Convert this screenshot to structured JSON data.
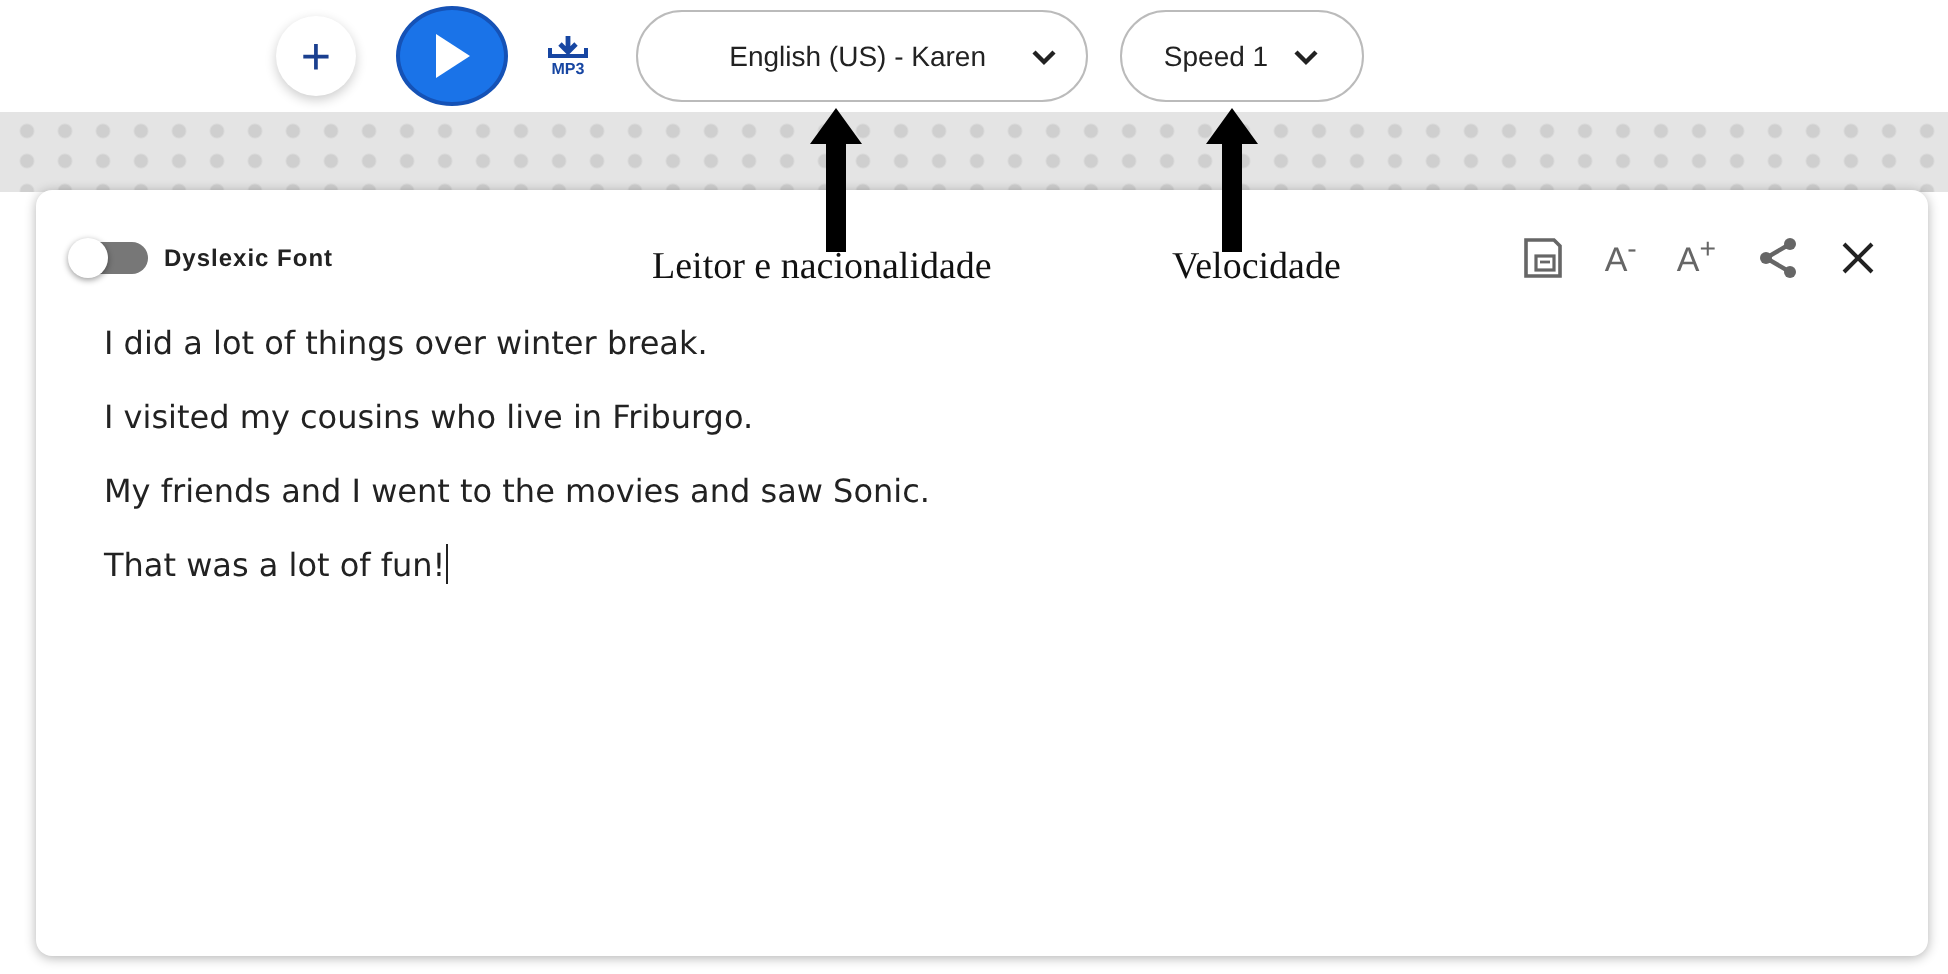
{
  "toolbar": {
    "add_button": "+",
    "mp3_label": "MP3",
    "voice": {
      "label": "English (US) - Karen"
    },
    "speed": {
      "label": "Speed 1"
    }
  },
  "annotations": [
    {
      "label": "Leitor e nacionalidade"
    },
    {
      "label": "Velocidade"
    }
  ],
  "editor": {
    "dyslexic_font": {
      "label": "Dyslexic Font",
      "on": false
    },
    "font_decrease": "A$^{-}$",
    "font_increase": "A$^{+}$",
    "lines": [
      "I did a lot of things over winter break.",
      "I visited my cousins who live in Friburgo.",
      "My friends and I went to the movies and saw Sonic.",
      "That was a lot of fun!"
    ]
  }
}
